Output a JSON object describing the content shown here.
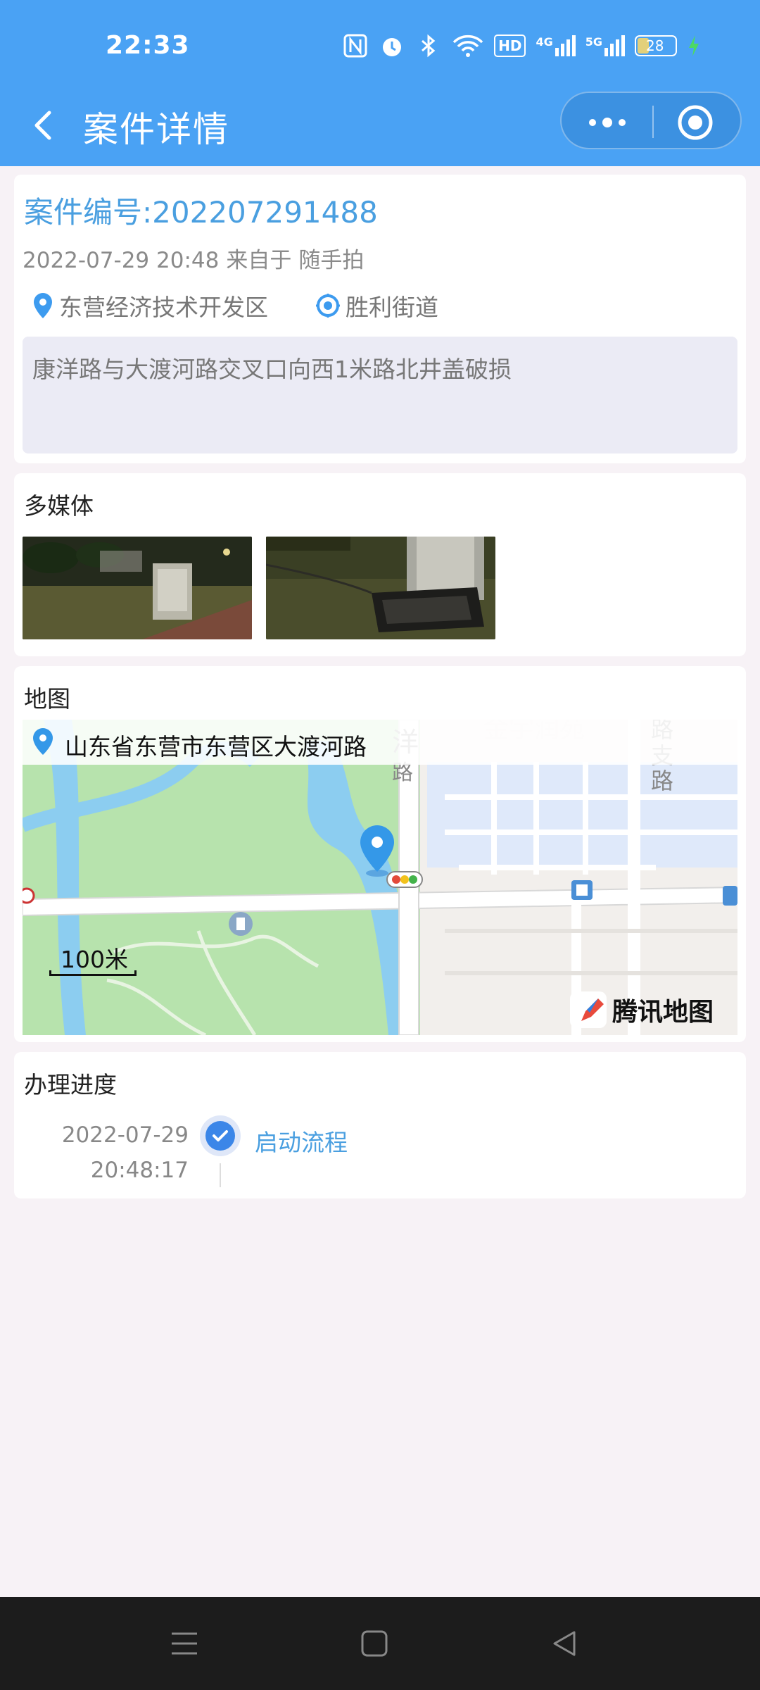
{
  "status_bar": {
    "time": "22:33",
    "icons": [
      "nfc-icon",
      "alarm-icon",
      "bluetooth-icon",
      "wifi-icon",
      "hd-icon",
      "signal-4g-icon",
      "signal-5g-icon",
      "battery-icon",
      "charging-icon"
    ],
    "network_4g": "4G",
    "network_5g": "5G",
    "hd": "HD",
    "battery_level": "28"
  },
  "nav": {
    "title": "案件详情",
    "back_icon": "chevron-left-icon",
    "more_icon": "more-dots-icon",
    "target_icon": "target-icon"
  },
  "case": {
    "number": "案件编号:202207291488",
    "datetime": "2022-07-29 20:48",
    "source_prefix": "来自于",
    "source": "随手拍",
    "district": "东营经济技术开发区",
    "street": "胜利街道",
    "description": "康洋路与大渡河路交叉口向西1米路北井盖破损"
  },
  "media": {
    "title": "多媒体",
    "thumbnails": [
      "photo-1",
      "photo-2"
    ]
  },
  "map": {
    "title": "地图",
    "address": "山东省东营市东营区大渡河路",
    "scale": "100米",
    "provider": "腾讯地图"
  },
  "progress": {
    "title": "办理进度",
    "steps": [
      {
        "date": "2022-07-29",
        "time": "20:48:17",
        "label": "启动流程"
      }
    ]
  },
  "colors": {
    "header": "#4aa2f4",
    "accent": "#4a9fe0",
    "page_bg": "#f7f2f6"
  }
}
